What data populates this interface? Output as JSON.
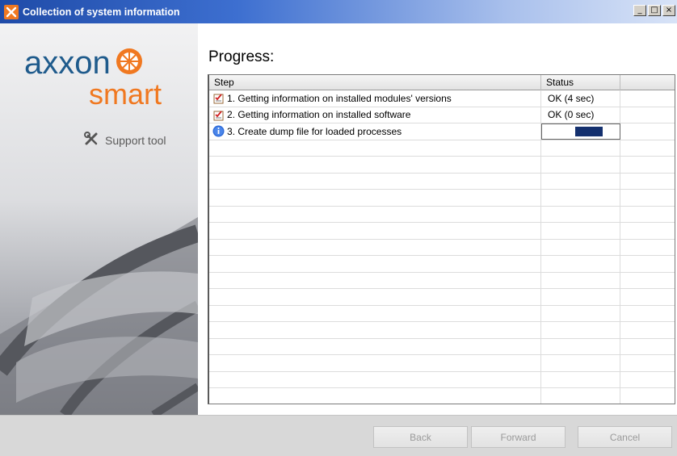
{
  "window": {
    "title": "Collection of system information",
    "controls": {
      "minimize": "_",
      "maximize": "□",
      "close": "×"
    }
  },
  "sidebar": {
    "logo_word_top": "axxon",
    "logo_word_bottom": "smart",
    "support_label": "Support tool",
    "support_icon": "tools-icon"
  },
  "main": {
    "heading": "Progress:",
    "columns": {
      "step": "Step",
      "status": "Status"
    },
    "rows": [
      {
        "step": "1. Getting information on installed modules' versions",
        "status": "OK (4 sec)",
        "icon": "checklist-icon"
      },
      {
        "step": "2. Getting information on installed software",
        "status": "OK (0 sec)",
        "icon": "checklist-icon"
      },
      {
        "step": "3. Create dump file for loaded processes",
        "status": "",
        "icon": "info-icon",
        "progress": 0.35
      }
    ]
  },
  "footer": {
    "back": "Back",
    "forward": "Forward",
    "cancel": "Cancel"
  },
  "colors": {
    "brand_orange": "#f07820",
    "title_blue": "#1f4ba8",
    "progress_fill": "#14306e"
  }
}
